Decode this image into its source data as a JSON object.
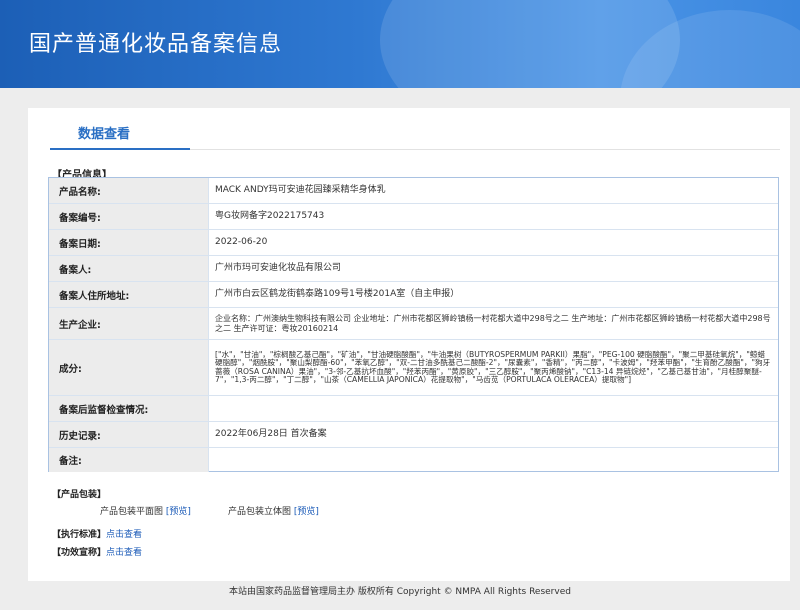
{
  "banner": {
    "title": "国产普通化妆品备案信息"
  },
  "tabs": {
    "active": "数据查看"
  },
  "sections": {
    "info": "【产品信息】",
    "package": "【产品包装】",
    "standard": "【执行标准】",
    "efficacy": "【功效宣称】"
  },
  "rows": [
    {
      "key": "产品名称:",
      "value": "MACK ANDY玛可安迪花园臻采精华身体乳"
    },
    {
      "key": "备案编号:",
      "value": "粤G妆网备字2022175743"
    },
    {
      "key": "备案日期:",
      "value": "2022-06-20"
    },
    {
      "key": "备案人:",
      "value": "广州市玛可安迪化妆品有限公司"
    },
    {
      "key": "备案人住所地址:",
      "value": "广州市白云区鹤龙街鹤泰路109号1号楼201A室（自主申报）"
    },
    {
      "key": "生产企业:",
      "value": "企业名称：广州澳纳生物科技有限公司 企业地址：广州市花都区狮岭镇杨一村花都大道中298号之二 生产地址：广州市花都区狮岭镇杨一村花都大道中298号之二 生产许可证：粤妆20160214"
    },
    {
      "key": "成分:",
      "value": "[\"水\"，\"甘油\"，\"棕榈酸乙基己酯\"，\"矿油\"，\"甘油硬脂酸酯\"，\"牛油果树（BUTYROSPERMUM PARKII）果脂\"，\"PEG-100 硬脂酸酯\"，\"聚二甲基硅氧烷\"，\"鲸蜡硬脂醇\"，\"烟酰胺\"，\"聚山梨醇酯-60\"，\"苯氧乙醇\"，\"双-二甘油多酰基己二酸酯-2\"，\"尿囊素\"，\"香精\"，\"丙二醇\"，\"卡波姆\"，\"羟苯甲酯\"，\"生育酚乙酸酯\"，\"狗牙蔷薇（ROSA CANINA）果油\"，\"3-邻-乙基抗坏血酸\"，\"羟苯丙酯\"，\"黄原胶\"，\"三乙醇胺\"，\"聚丙烯酸钠\"，\"C13-14 异链烷烃\"，\"乙基己基甘油\"，\"月桂醇聚醚-7\"，\"1,3-丙二醇\"，\"丁二醇\"，\"山茶（CAMELLIA JAPONICA）花提取物\"，\"马齿苋（PORTULACA OLERACEA）提取物\"]"
    },
    {
      "key": "备案后监督检查情况:",
      "value": ""
    },
    {
      "key": "历史记录:",
      "value": "2022年06月28日 首次备案"
    },
    {
      "key": "备注:",
      "value": ""
    }
  ],
  "package": {
    "flat_label": "产品包装平面图",
    "flat_link": "[预览]",
    "solid_label": "产品包装立体图",
    "solid_link": "[预览]"
  },
  "standard": {
    "link": "点击查看"
  },
  "efficacy": {
    "link": "点击查看"
  },
  "footer": {
    "text": "本站由国家药品监督管理局主办 版权所有 Copyright © NMPA All Rights Reserved"
  }
}
